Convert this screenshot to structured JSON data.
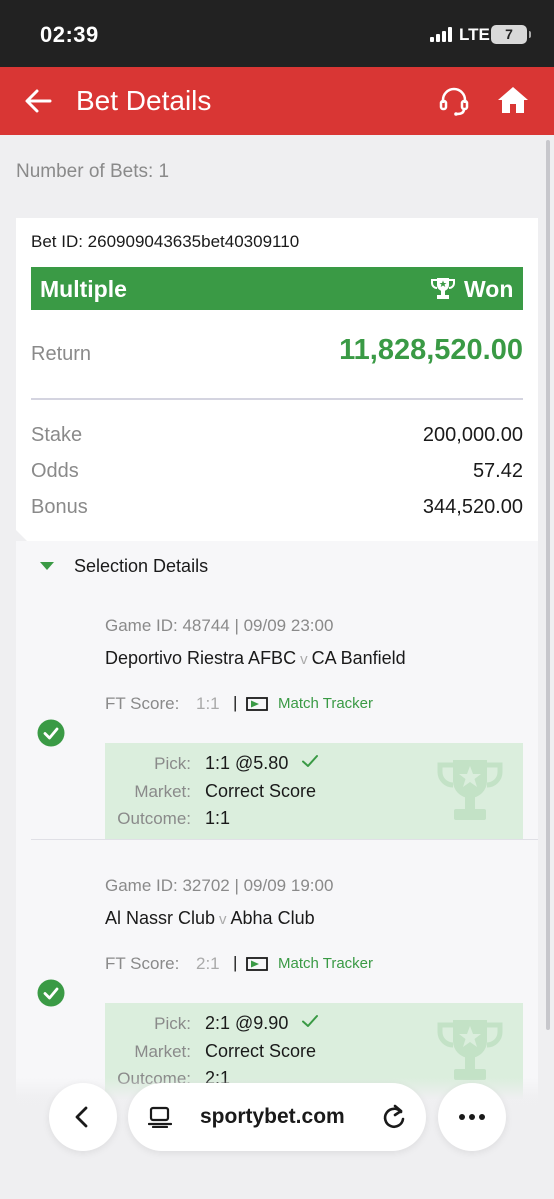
{
  "status_bar": {
    "time": "02:39",
    "network": "LTE",
    "battery": "7"
  },
  "header": {
    "title": "Bet Details"
  },
  "summary": {
    "number_of_bets": "Number of Bets: 1"
  },
  "bet": {
    "bet_id": "Bet ID: 260909043635bet40309110",
    "type": "Multiple",
    "status": "Won",
    "return_label": "Return",
    "return_value": "11,828,520.00",
    "stake_label": "Stake",
    "stake_value": "200,000.00",
    "odds_label": "Odds",
    "odds_value": "57.42",
    "bonus_label": "Bonus",
    "bonus_value": "344,520.00"
  },
  "selection": {
    "title": "Selection Details",
    "games": [
      {
        "game_id": "Game ID: 48744 | 09/09 23:00",
        "home": "Deportivo Riestra AFBC",
        "vs": "v",
        "away": "CA Banfield",
        "ft_label": "FT Score:",
        "ft_score": "1:1",
        "separator": "|",
        "tracker": "Match Tracker",
        "pick_label": "Pick:",
        "pick": "1:1 @5.80",
        "market_label": "Market:",
        "market": "Correct Score",
        "outcome_label": "Outcome:",
        "outcome": "1:1"
      },
      {
        "game_id": "Game ID: 32702 | 09/09 19:00",
        "home": "Al Nassr Club",
        "vs": "v",
        "away": "Abha Club",
        "ft_label": "FT Score:",
        "ft_score": "2:1",
        "separator": "|",
        "tracker": "Match Tracker",
        "pick_label": "Pick:",
        "pick": "2:1 @9.90",
        "market_label": "Market:",
        "market": "Correct Score",
        "outcome_label": "Outcome:",
        "outcome": "2:1"
      }
    ]
  },
  "browser": {
    "url": "sportybet.com"
  },
  "colors": {
    "brand_red": "#d93634",
    "win_green": "#3a9a45",
    "pick_bg": "#dbeedd"
  }
}
